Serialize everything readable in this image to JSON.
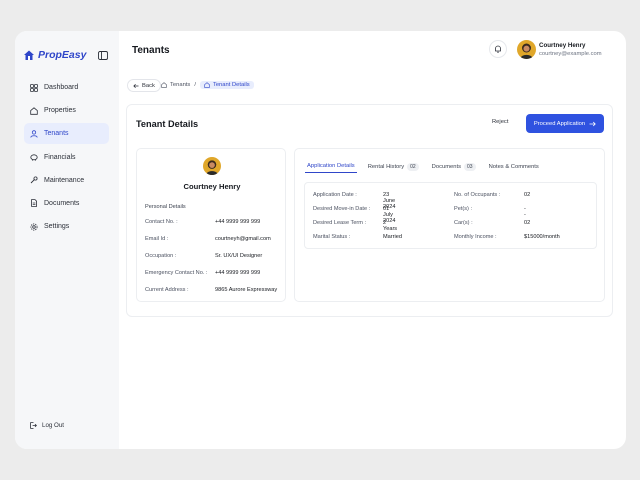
{
  "app": {
    "name": "PropEasy"
  },
  "colors": {
    "accent": "#2f52e0",
    "active_bg": "#e8edfd"
  },
  "sidebar": {
    "items": [
      {
        "label": "Dashboard",
        "icon": "dashboard-icon"
      },
      {
        "label": "Properties",
        "icon": "home-icon"
      },
      {
        "label": "Tenants",
        "icon": "user-icon",
        "active": true
      },
      {
        "label": "Financials",
        "icon": "piggy-bank-icon"
      },
      {
        "label": "Maintenance",
        "icon": "wrench-icon"
      },
      {
        "label": "Documents",
        "icon": "document-icon"
      },
      {
        "label": "Settings",
        "icon": "gear-icon"
      }
    ],
    "logout_label": "Log Out"
  },
  "header": {
    "title": "Tenants",
    "user": {
      "name": "Courtney Henry",
      "email": "courtney@example.com"
    }
  },
  "breadcrumb": {
    "back_label": "Back",
    "items": [
      "Tenants",
      "Tenant Details"
    ]
  },
  "details": {
    "title": "Tenant Details",
    "reject_label": "Reject",
    "proceed_label": "Proceed Application"
  },
  "profile": {
    "name": "Courtney Henry",
    "section_title": "Personal Details",
    "fields": [
      {
        "label": "Contact No. :",
        "value": "+44 9999 999 999"
      },
      {
        "label": "Email Id :",
        "value": "courtneyh@gmail.com"
      },
      {
        "label": "Occupation :",
        "value": "Sr. UX/UI Designer"
      },
      {
        "label": "Emergency Contact No. :",
        "value": "+44 9999 999 999"
      },
      {
        "label": "Current Address :",
        "value": "9865 Aurore Expressway"
      }
    ]
  },
  "tabs": [
    {
      "label": "Application Details",
      "active": true
    },
    {
      "label": "Rental History",
      "count": "02"
    },
    {
      "label": "Documents",
      "count": "03"
    },
    {
      "label": "Notes & Comments"
    }
  ],
  "application": {
    "left": [
      {
        "label": "Application Date :",
        "value": "23 June 2024"
      },
      {
        "label": "Desired Move-in Date :",
        "value": "01 July 2024"
      },
      {
        "label": "Desired Lease Term :",
        "value": "2 Years"
      },
      {
        "label": "Marital Status :",
        "value": "Married"
      }
    ],
    "right": [
      {
        "label": "No. of Occupants :",
        "value": "02"
      },
      {
        "label": "Pet(s) :",
        "value": "--"
      },
      {
        "label": "Car(s) :",
        "value": "02"
      },
      {
        "label": "Monthly Income :",
        "value": "$15000/month"
      }
    ]
  }
}
